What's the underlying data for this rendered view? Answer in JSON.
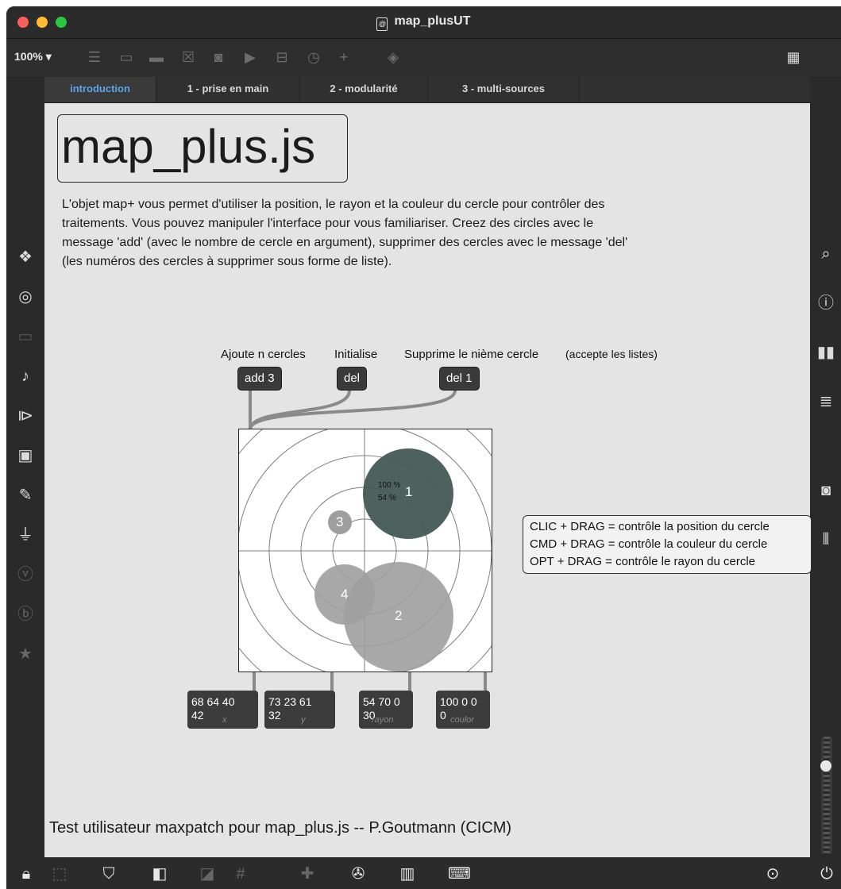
{
  "window": {
    "title": "map_plusUT"
  },
  "toolbar": {
    "zoom": "100% ▾"
  },
  "tabs": [
    {
      "label": "introduction"
    },
    {
      "label": "1 - prise en main"
    },
    {
      "label": "2 - modularité"
    },
    {
      "label": "3 - multi-sources"
    }
  ],
  "patch": {
    "title": "map_plus.js",
    "description": "L'objet map+ vous permet d'utiliser la position, le rayon et la couleur du cercle pour contrôler des traitements. Vous pouvez manipuler l'interface pour vous familiariser. Creez des circles avec le message 'add' (avec le nombre de cercle en argument), supprimer des cercles avec le message 'del' (les numéros des cercles à supprimer sous forme de liste).",
    "labels": {
      "add": "Ajoute n cercles",
      "init": "Initialise",
      "del": "Supprime le nième cercle",
      "lists": "(accepte les listes)"
    },
    "messages": {
      "add": "add 3",
      "del": "del",
      "del1": "del 1"
    },
    "circles": {
      "c1": "1",
      "c1_pct1": "100 %",
      "c1_pct2": "54 %",
      "c2": "2",
      "c3": "3",
      "c4": "4"
    },
    "comment": {
      "line1": "CLIC + DRAG = contrôle la position du cercle",
      "line2": "CMD + DRAG = contrôle la couleur du cercle",
      "line3": "OPT + DRAG = contrôle le rayon du cercle"
    },
    "outputs": [
      {
        "line1": "68 64 40",
        "line2": "42",
        "caption": "x"
      },
      {
        "line1": "73 23 61",
        "line2": "32",
        "caption": "y"
      },
      {
        "line1": "54 70 0",
        "line2": "30",
        "caption": "rayon"
      },
      {
        "line1": "100 0 0",
        "line2": "0",
        "caption": "coulor"
      }
    ],
    "footer": "Test utilisateur maxpatch pour map_plus.js -- P.Goutmann (CICM)"
  },
  "colors": {
    "dark_circle": "#3f5653",
    "grey_circle": "#9e9e9e",
    "tab_active": "#5aa5e8"
  }
}
